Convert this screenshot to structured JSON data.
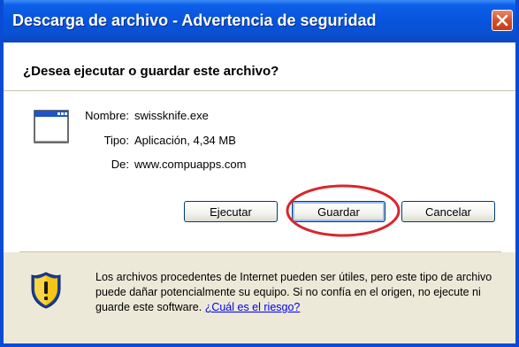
{
  "window": {
    "title": "Descarga de archivo - Advertencia de seguridad"
  },
  "dialog": {
    "question": "¿Desea ejecutar o guardar este archivo?",
    "file": {
      "name_label": "Nombre:",
      "name_value": "swissknife.exe",
      "type_label": "Tipo:",
      "type_value": "Aplicación, 4,34 MB",
      "from_label": "De:",
      "from_value": "www.compuapps.com"
    },
    "buttons": {
      "run": "Ejecutar",
      "save": "Guardar",
      "cancel": "Cancelar"
    },
    "warning": {
      "text": "Los archivos procedentes de Internet pueden ser útiles, pero este tipo de archivo puede dañar potencialmente su equipo. Si no confía en el origen, no ejecute ni guarde este software. ",
      "link": "¿Cuál es el riesgo?"
    }
  },
  "colors": {
    "titlebar": "#0754dc",
    "highlight_ellipse": "#d9262c",
    "link": "#0000ee"
  },
  "icons": [
    "close-icon",
    "application-window-icon",
    "security-shield-icon"
  ]
}
